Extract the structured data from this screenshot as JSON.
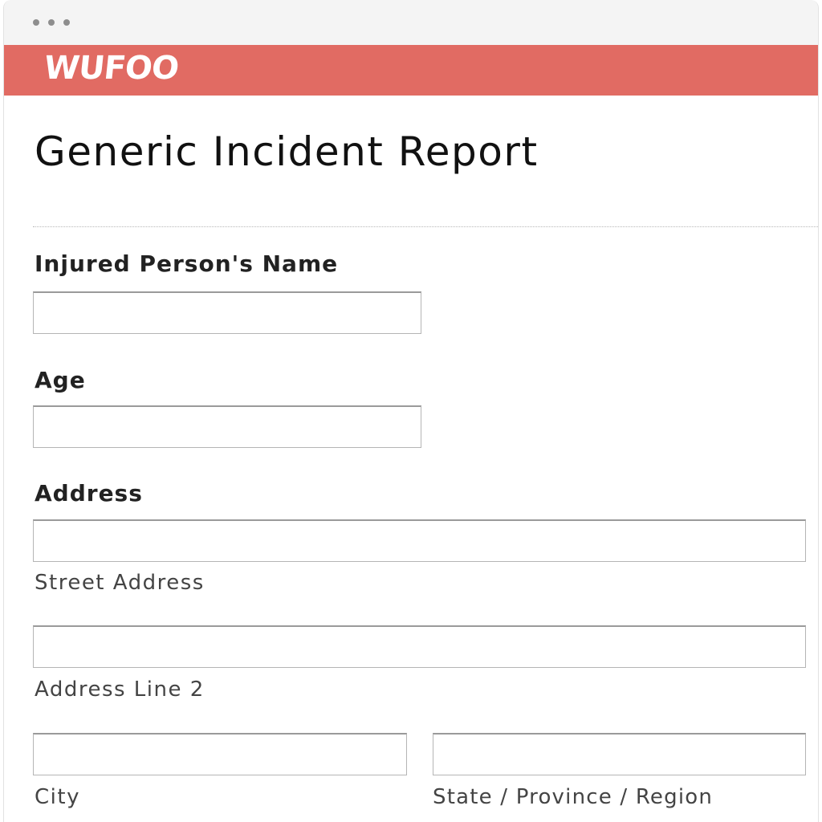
{
  "app": {
    "logo_text": "WUFOO",
    "brand_color": "#e16b63"
  },
  "form": {
    "title": "Generic Incident Report",
    "fields": {
      "name": {
        "label": "Injured Person's Name",
        "value": ""
      },
      "age": {
        "label": "Age",
        "value": ""
      },
      "address": {
        "label": "Address",
        "street": {
          "sublabel": "Street Address",
          "value": ""
        },
        "line2": {
          "sublabel": "Address Line 2",
          "value": ""
        },
        "city": {
          "sublabel": "City",
          "value": ""
        },
        "state": {
          "sublabel": "State / Province / Region",
          "value": ""
        }
      }
    }
  }
}
